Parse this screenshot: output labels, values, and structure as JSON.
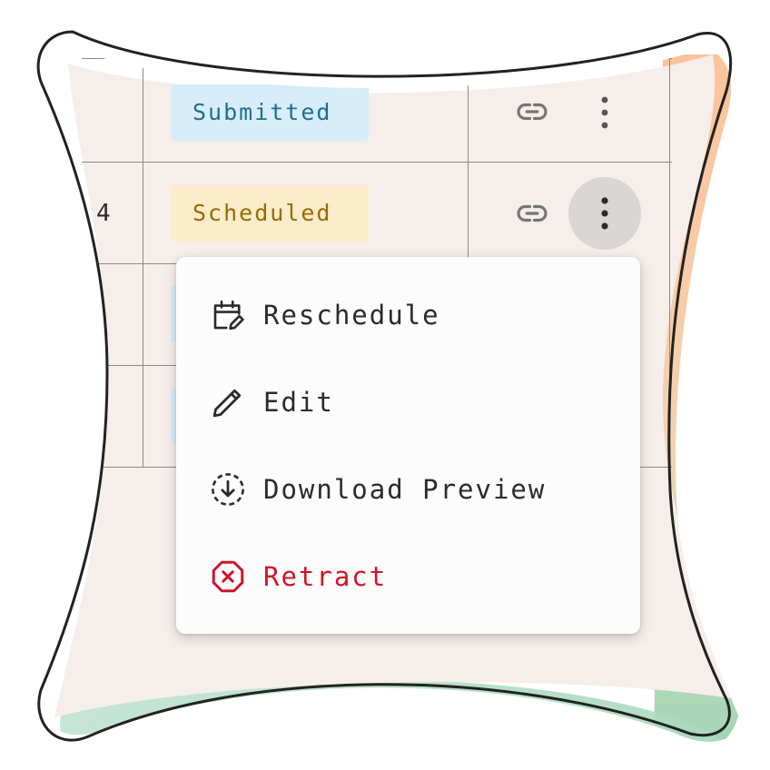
{
  "table": {
    "rows": [
      {
        "id": "",
        "status": "Submitted"
      },
      {
        "id": "4",
        "status": "Scheduled"
      }
    ]
  },
  "statuses": {
    "submitted": {
      "bg": "#d7eef8",
      "fg": "#1f6f8f"
    },
    "scheduled": {
      "bg": "#fbeccb",
      "fg": "#9a6a00"
    }
  },
  "menu": {
    "items": [
      {
        "label": "Reschedule",
        "icon": "calendar-edit-icon"
      },
      {
        "label": "Edit",
        "icon": "pencil-icon"
      },
      {
        "label": "Download Preview",
        "icon": "download-circle-icon"
      },
      {
        "label": "Retract",
        "icon": "close-octagon-icon",
        "color": "#d0142c"
      }
    ]
  },
  "colors": {
    "surface": "#f6eeea",
    "menu_bg": "#fcfcfc",
    "accent_orange": "#f7b388",
    "accent_green": "#9fd3b7",
    "more_button_active": "#d9d6d3"
  }
}
